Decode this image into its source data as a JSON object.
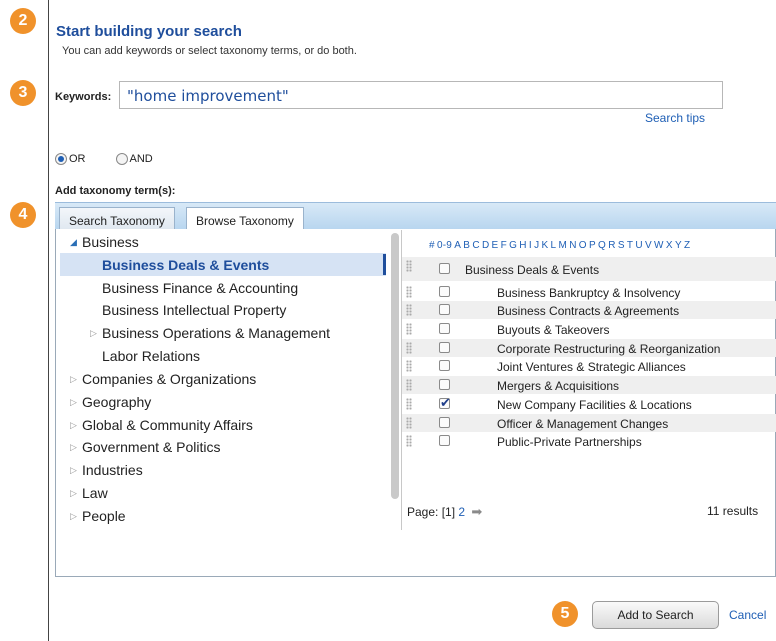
{
  "callouts": [
    "2",
    "3",
    "4",
    "5"
  ],
  "header": {
    "title": "Start building your search",
    "subtitle": "You can add keywords or select taxonomy terms, or do both."
  },
  "keywords": {
    "label": "Keywords:",
    "value": "\"home improvement\"",
    "search_tips": "Search tips"
  },
  "operator": {
    "options": [
      "OR",
      "AND"
    ],
    "selected": "OR"
  },
  "taxonomy": {
    "label": "Add taxonomy term(s):",
    "tabs": [
      "Search Taxonomy",
      "Browse Taxonomy"
    ],
    "active_tab": "Browse Taxonomy",
    "tree": [
      {
        "label": "Business",
        "expanded": true
      },
      {
        "label": "Business Deals & Events",
        "selected": true
      },
      {
        "label": "Business Finance & Accounting"
      },
      {
        "label": "Business Intellectual Property"
      },
      {
        "label": "Business Operations & Management",
        "expandable": true
      },
      {
        "label": "Labor Relations"
      },
      {
        "label": "Companies & Organizations",
        "expandable": true
      },
      {
        "label": "Geography",
        "expandable": true
      },
      {
        "label": "Global & Community Affairs",
        "expandable": true
      },
      {
        "label": "Government & Politics",
        "expandable": true
      },
      {
        "label": "Industries",
        "expandable": true
      },
      {
        "label": "Law",
        "expandable": true
      },
      {
        "label": "People",
        "expandable": true
      }
    ],
    "alphabet": [
      "#",
      "0-9",
      "A",
      "B",
      "C",
      "D",
      "E",
      "F",
      "G",
      "H",
      "I",
      "J",
      "K",
      "L",
      "M",
      "N",
      "O",
      "P",
      "Q",
      "R",
      "S",
      "T",
      "U",
      "V",
      "W",
      "X",
      "Y",
      "Z"
    ],
    "terms": [
      {
        "label": "Business Deals & Events",
        "checked": false
      },
      {
        "label": "Business Bankruptcy & Insolvency",
        "checked": false
      },
      {
        "label": "Business Contracts & Agreements",
        "checked": false
      },
      {
        "label": "Buyouts & Takeovers",
        "checked": false
      },
      {
        "label": "Corporate Restructuring & Reorganization",
        "checked": false
      },
      {
        "label": "Joint Ventures & Strategic Alliances",
        "checked": false
      },
      {
        "label": "Mergers & Acquisitions",
        "checked": false
      },
      {
        "label": "New Company Facilities & Locations",
        "checked": true
      },
      {
        "label": "Officer & Management Changes",
        "checked": false
      },
      {
        "label": "Public-Private Partnerships",
        "checked": false
      }
    ],
    "pager": {
      "label": "Page:",
      "current": "[1]",
      "next_page": "2"
    },
    "results": "11 results"
  },
  "actions": {
    "add": "Add to Search",
    "cancel": "Cancel"
  }
}
